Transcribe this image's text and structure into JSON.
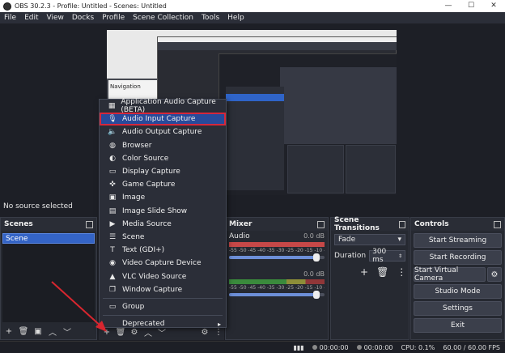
{
  "window": {
    "title": "OBS 30.2.3 - Profile: Untitled - Scenes: Untitled"
  },
  "menu": [
    "File",
    "Edit",
    "View",
    "Docks",
    "Profile",
    "Scene Collection",
    "Tools",
    "Help"
  ],
  "preview": {
    "nav_label": "Navigation"
  },
  "status_text": "No source selected",
  "scenes": {
    "title": "Scenes",
    "items": [
      "Scene"
    ]
  },
  "context_menu": {
    "items": [
      {
        "label": "Application Audio Capture (BETA)",
        "icon": "app-audio-icon"
      },
      {
        "label": "Audio Input Capture",
        "icon": "microphone-icon",
        "selected": true
      },
      {
        "label": "Audio Output Capture",
        "icon": "speaker-icon"
      },
      {
        "label": "Browser",
        "icon": "globe-icon"
      },
      {
        "label": "Color Source",
        "icon": "palette-icon"
      },
      {
        "label": "Display Capture",
        "icon": "monitor-icon"
      },
      {
        "label": "Game Capture",
        "icon": "gamepad-icon"
      },
      {
        "label": "Image",
        "icon": "image-icon"
      },
      {
        "label": "Image Slide Show",
        "icon": "slideshow-icon"
      },
      {
        "label": "Media Source",
        "icon": "play-icon"
      },
      {
        "label": "Scene",
        "icon": "scene-icon"
      },
      {
        "label": "Text (GDI+)",
        "icon": "text-icon"
      },
      {
        "label": "Video Capture Device",
        "icon": "camera-icon"
      },
      {
        "label": "VLC Video Source",
        "icon": "vlc-icon"
      },
      {
        "label": "Window Capture",
        "icon": "window-icon"
      }
    ],
    "group": "Group",
    "deprecated": "Deprecated"
  },
  "mixer": {
    "title": "Mixer",
    "tracks": [
      {
        "name": "Audio",
        "db": "0.0 dB"
      },
      {
        "name": "",
        "db": "0.0 dB"
      }
    ],
    "scale": "-55 -50 -45 -40 -35 -30 -25 -20 -15 -10 -5 0"
  },
  "transitions": {
    "title": "Scene Transitions",
    "type": "Fade",
    "duration_label": "Duration",
    "duration_value": "300 ms"
  },
  "controls": {
    "title": "Controls",
    "buttons": [
      "Start Streaming",
      "Start Recording",
      "Start Virtual Camera",
      "Studio Mode",
      "Settings",
      "Exit"
    ]
  },
  "statusbar": {
    "rec_time": "00:00:00",
    "stream_time": "00:00:00",
    "cpu": "CPU: 0.1%",
    "fps": "60.00 / 60.00 FPS"
  }
}
